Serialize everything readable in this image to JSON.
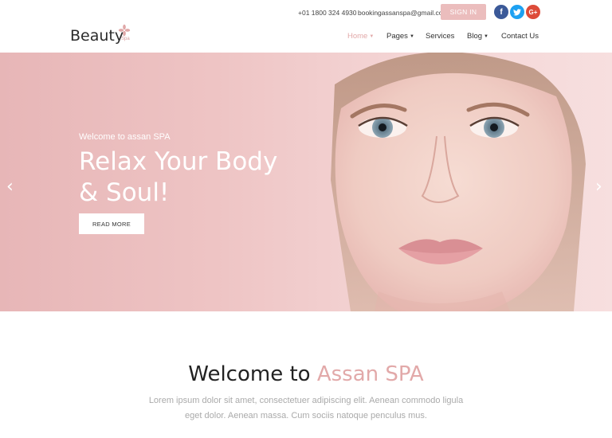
{
  "topbar": {
    "phone": "+01 1800 324 4930",
    "email": "bookingassanspa@gmail.com",
    "signin_label": "SIGN IN",
    "social": {
      "facebook": "f",
      "twitter": "t",
      "google": "G+"
    }
  },
  "brand": {
    "name": "Beauty",
    "sub": "Spa"
  },
  "nav": {
    "home": "Home",
    "pages": "Pages",
    "services": "Services",
    "blog": "Blog",
    "contact": "Contact Us"
  },
  "hero": {
    "kicker": "Welcome to assan SPA",
    "title_line1": "Relax Your Body",
    "title_line2": "& Soul!",
    "button_label": "READ MORE",
    "prev": "‹",
    "next": "›"
  },
  "welcome": {
    "title_plain": "Welcome to ",
    "title_accent": "Assan SPA",
    "text": "Lorem ipsum dolor sit amet, consectetuer adipiscing elit. Aenean commodo ligula eget dolor. Aenean massa. Cum sociis natoque penculus mus."
  },
  "colors": {
    "accent": "#e2a9a9",
    "signin_bg": "#ebbdbd",
    "hero_bg": "#eec4c4"
  }
}
